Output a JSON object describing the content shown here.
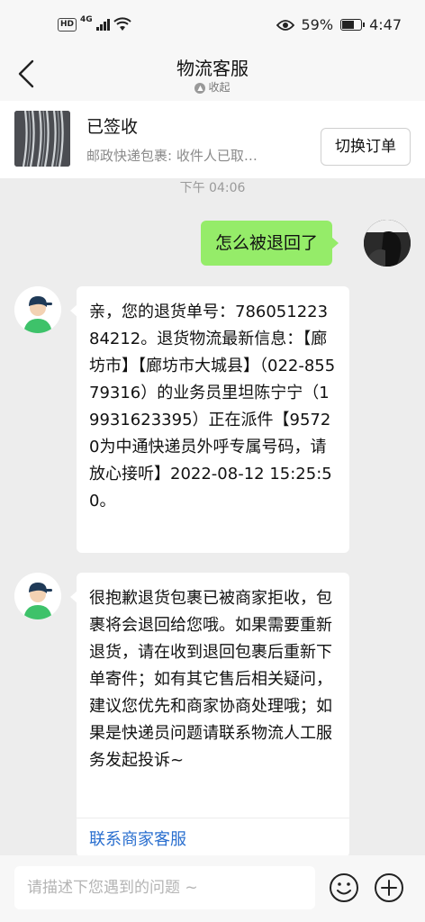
{
  "status_bar": {
    "hd": "HD",
    "network": "4G",
    "battery_percent": "59%",
    "battery_level": 0.59,
    "time": "4:47"
  },
  "header": {
    "title": "物流客服",
    "collapse_label": "收起"
  },
  "order": {
    "status": "已签收",
    "description": "邮政快递包裹: 收件人已取…",
    "switch_label": "切换订单"
  },
  "chat": {
    "timestamp": "下午 04:06",
    "outgoing": "怎么被退回了",
    "incoming_1": "亲，您的退货单号：78605122384212。退货物流最新信息：【廊坊市】【廊坊市大城县】（022-85579316）的业务员里坦陈宁宁（19931623395）正在派件【95720为中通快递员外呼专属号码，请放心接听】2022-08-12 15:25:50。",
    "incoming_2": "很抱歉退货包裹已被商家拒收，包裹将会退回给您哦。如果需要重新退货，请在收到退回包裹后重新下单寄件；如有其它售后相关疑问，建议您优先和商家协商处理哦；如果是快递员问题请联系物流人工服务发起投诉~",
    "contact_link": "联系商家客服"
  },
  "input": {
    "placeholder": "请描述下您遇到的问题 ~"
  },
  "colors": {
    "bubble_out": "#95ec69",
    "link": "#2a6fcf",
    "avatar_green": "#3ec26a"
  }
}
